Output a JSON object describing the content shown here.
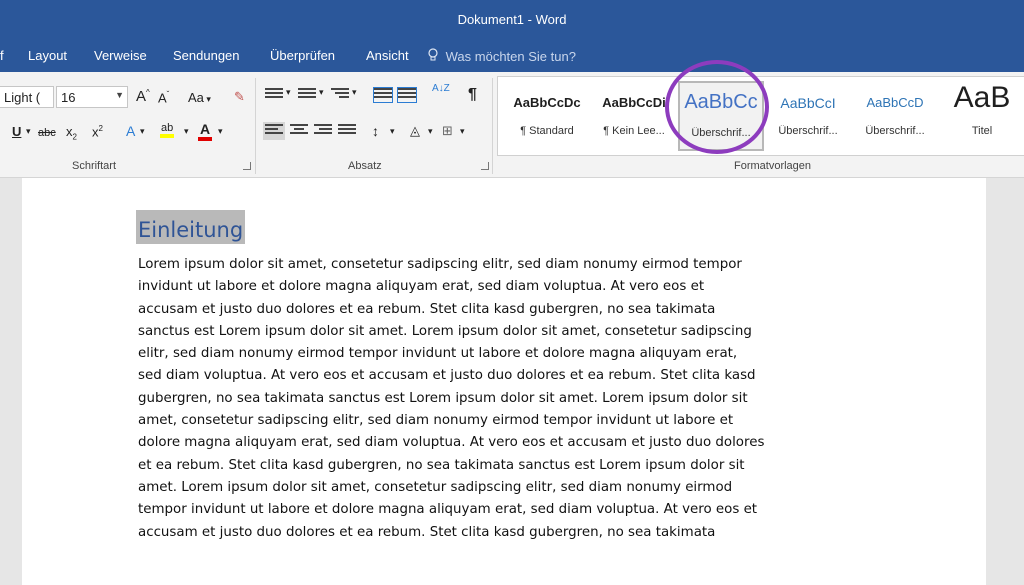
{
  "window": {
    "title": "Dokument1 - Word"
  },
  "menu": {
    "tabs": [
      {
        "id": "cut",
        "label": "f"
      },
      {
        "id": "layout",
        "label": "Layout"
      },
      {
        "id": "verweise",
        "label": "Verweise"
      },
      {
        "id": "sendungen",
        "label": "Sendungen"
      },
      {
        "id": "ueberpruefen",
        "label": "Überprüfen"
      },
      {
        "id": "ansicht",
        "label": "Ansicht"
      }
    ],
    "tell_me": "Was möchten Sie tun?"
  },
  "ribbon": {
    "font": {
      "name": "Light (",
      "size": "16",
      "group_label": "Schriftart",
      "grow": "A",
      "shrink": "A",
      "case": "Aa",
      "underline": "U",
      "strike": "abc",
      "subscript": "x",
      "superscript": "x",
      "sub_mark": "2",
      "sup_mark": "2",
      "effects": "A",
      "highlight": "ab",
      "color": "A"
    },
    "paragraph": {
      "group_label": "Absatz",
      "sort": "A↓Z",
      "pilcrow": "¶"
    },
    "styles": {
      "group_label": "Formatvorlagen",
      "items": [
        {
          "sample": "AaBbCcDc",
          "name": "¶ Standard",
          "color": "#1f1f1f"
        },
        {
          "sample": "AaBbCcDi",
          "name": "¶ Kein Lee...",
          "color": "#1f1f1f"
        },
        {
          "sample": "AaBbCc",
          "name": "Überschrif...",
          "color": "#4472c4"
        },
        {
          "sample": "AaBbCcI",
          "name": "Überschrif...",
          "color": "#2e74b5"
        },
        {
          "sample": "AaBbCcD",
          "name": "Überschrif...",
          "color": "#2e74b5"
        },
        {
          "sample": "AaB",
          "name": "Titel",
          "color": "#1f1f1f"
        }
      ]
    }
  },
  "document": {
    "heading": "Einleitung",
    "lines": [
      "Lorem ipsum dolor sit amet, consetetur sadipscing elitr, sed diam nonumy eirmod tempor",
      "invidunt ut labore et dolore magna aliquyam erat, sed diam voluptua. At vero eos et",
      "accusam et justo duo dolores et ea rebum. Stet clita kasd gubergren, no sea takimata",
      "sanctus est Lorem ipsum dolor sit amet. Lorem ipsum dolor sit amet, consetetur sadipscing",
      "elitr, sed diam nonumy eirmod tempor invidunt ut labore et dolore magna aliquyam erat,",
      "sed diam voluptua. At vero eos et accusam et justo duo dolores et ea rebum. Stet clita kasd",
      "gubergren, no sea takimata sanctus est Lorem ipsum dolor sit amet. Lorem ipsum dolor sit",
      "amet, consetetur sadipscing elitr, sed diam nonumy eirmod tempor invidunt ut labore et",
      "dolore magna aliquyam erat, sed diam voluptua. At vero eos et accusam et justo duo dolores",
      "et ea rebum. Stet clita kasd gubergren, no sea takimata sanctus est Lorem ipsum dolor sit",
      "amet. Lorem ipsum dolor sit amet, consetetur sadipscing elitr, sed diam nonumy eirmod",
      "tempor invidunt ut labore et dolore magna aliquyam erat, sed diam voluptua. At vero eos et",
      "accusam et justo duo dolores et ea rebum. Stet clita kasd gubergren, no sea takimata"
    ]
  }
}
